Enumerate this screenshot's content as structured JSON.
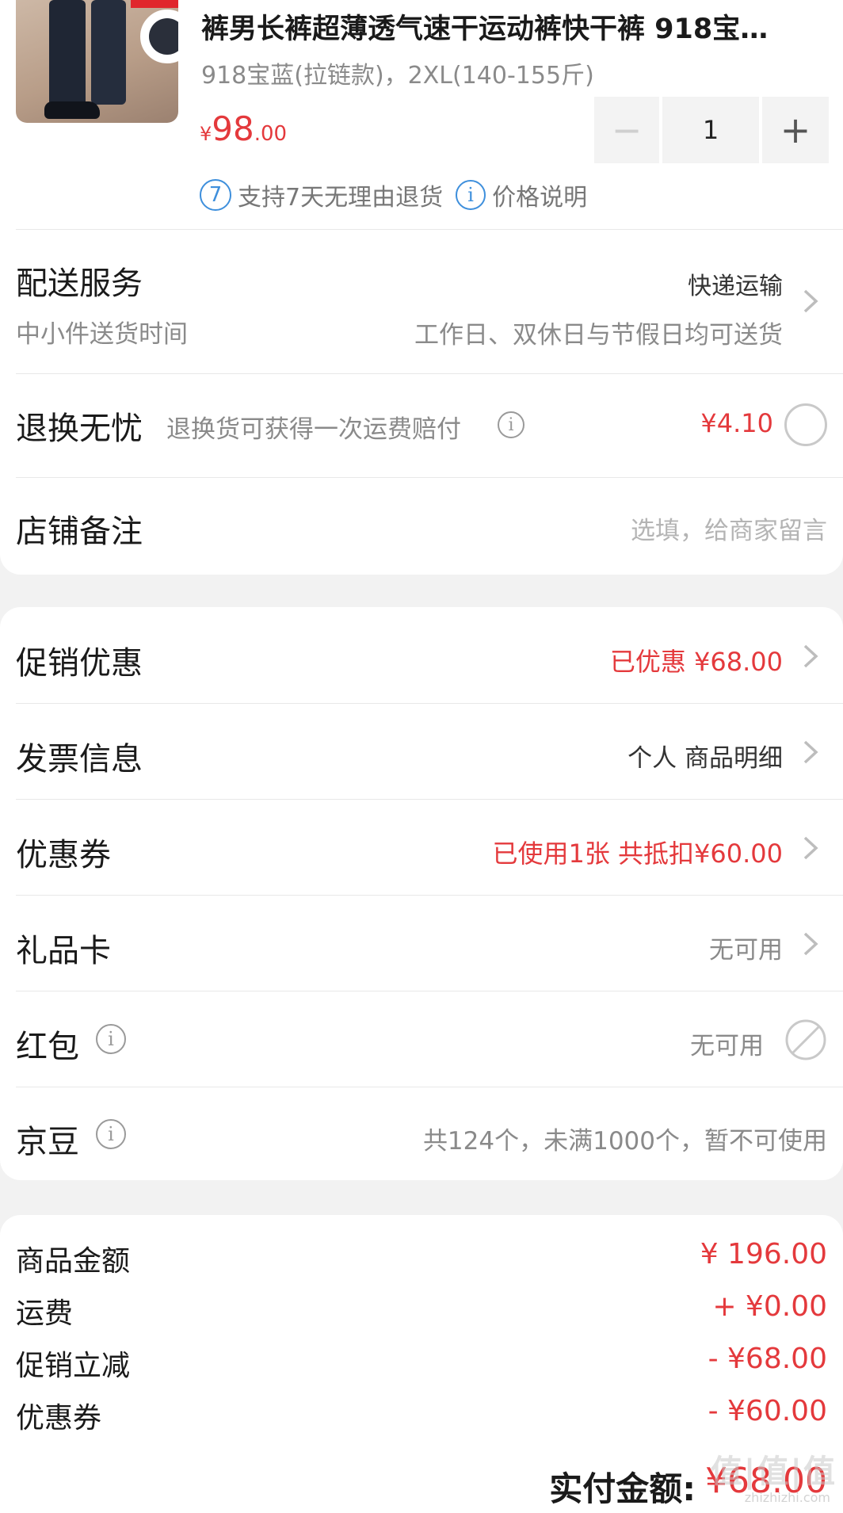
{
  "product": {
    "title": "裤男长裤超薄透气速干运动裤快干裤 918宝…",
    "spec": "918宝蓝(拉链款)，2XL(140-155斤)",
    "price_currency": "¥",
    "price_int": "98",
    "price_dec": ".00",
    "quantity": "1",
    "minus": "−",
    "plus": "+",
    "return_badge": "7",
    "return_text": "支持7天无理由退货",
    "price_info_text": "价格说明"
  },
  "delivery": {
    "label": "配送服务",
    "method": "快递运输",
    "sub_label": "中小件送货时间",
    "sub_value": "工作日、双休日与节假日均可送货"
  },
  "return_insurance": {
    "label": "退换无忧",
    "desc": "退换货可获得一次运费赔付",
    "price": "¥4.10"
  },
  "store_note": {
    "label": "店铺备注",
    "placeholder": "选填，给商家留言"
  },
  "promo": {
    "label": "促销优惠",
    "value": "已优惠 ¥68.00"
  },
  "invoice": {
    "label": "发票信息",
    "value": "个人 商品明细"
  },
  "coupon": {
    "label": "优惠券",
    "value": "已使用1张 共抵扣¥60.00"
  },
  "giftcard": {
    "label": "礼品卡",
    "value": "无可用"
  },
  "redpacket": {
    "label": "红包",
    "value": "无可用"
  },
  "jingdou": {
    "label": "京豆",
    "value": "共124个，未满1000个，暂不可使用"
  },
  "summary": {
    "rows": [
      {
        "label": "商品金额",
        "value": "¥ 196.00"
      },
      {
        "label": "运费",
        "value": "+ ¥0.00"
      },
      {
        "label": "促销立减",
        "value": "- ¥68.00"
      },
      {
        "label": "优惠券",
        "value": "- ¥60.00"
      }
    ],
    "pay_label": "实付金额:",
    "pay_value": "¥68.00"
  },
  "watermark": {
    "main": "值|值|值",
    "sub": "zhizhizhi.com"
  },
  "colors": {
    "accent_red": "#e4393c",
    "blue": "#3e8fdc"
  }
}
